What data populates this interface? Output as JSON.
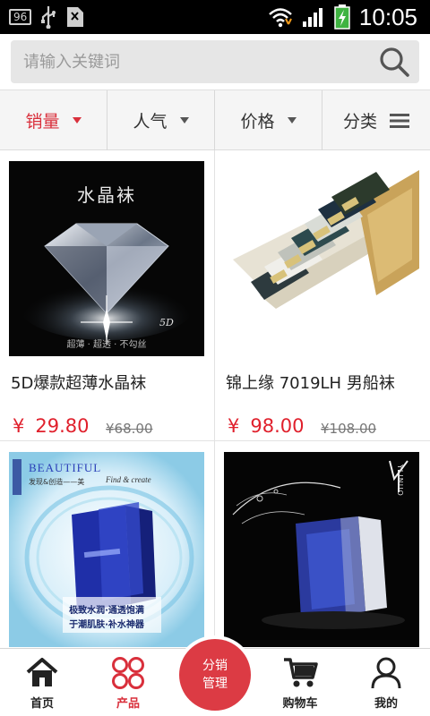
{
  "statusbar": {
    "badge": "96",
    "time": "10:05"
  },
  "search": {
    "placeholder": "请输入关键词"
  },
  "filters": [
    {
      "label": "销量",
      "active": true
    },
    {
      "label": "人气",
      "active": false
    },
    {
      "label": "价格",
      "active": false
    },
    {
      "label": "分类",
      "active": false
    }
  ],
  "products": [
    {
      "name": "5D爆款超薄水晶袜",
      "currency": "¥",
      "price": "29.80",
      "original_price": "¥68.00",
      "image_text": "水晶袜",
      "image_caption": "超薄 · 超透 · 不勾丝",
      "image_mark": "5D"
    },
    {
      "name": "锦上缘  7019LH 男船袜",
      "currency": "¥",
      "price": "98.00",
      "original_price": "¥108.00"
    },
    {
      "name": "",
      "image_title": "BEAUTIFUL",
      "image_sub": "发现&创造——美",
      "image_sub2": "Find & create",
      "image_caption": "极致水润·通透饱满",
      "image_caption2": "于潮肌肤·补水神器"
    },
    {
      "name": "",
      "image_brand": "YLINUO"
    }
  ],
  "bottom_nav": {
    "home": "首页",
    "products": "产品",
    "center_line1": "分销",
    "center_line2": "管理",
    "cart": "购物车",
    "mine": "我的"
  },
  "colors": {
    "accent": "#d9303c",
    "statusbar": "#000000",
    "search_bg": "#e6e6e6"
  }
}
